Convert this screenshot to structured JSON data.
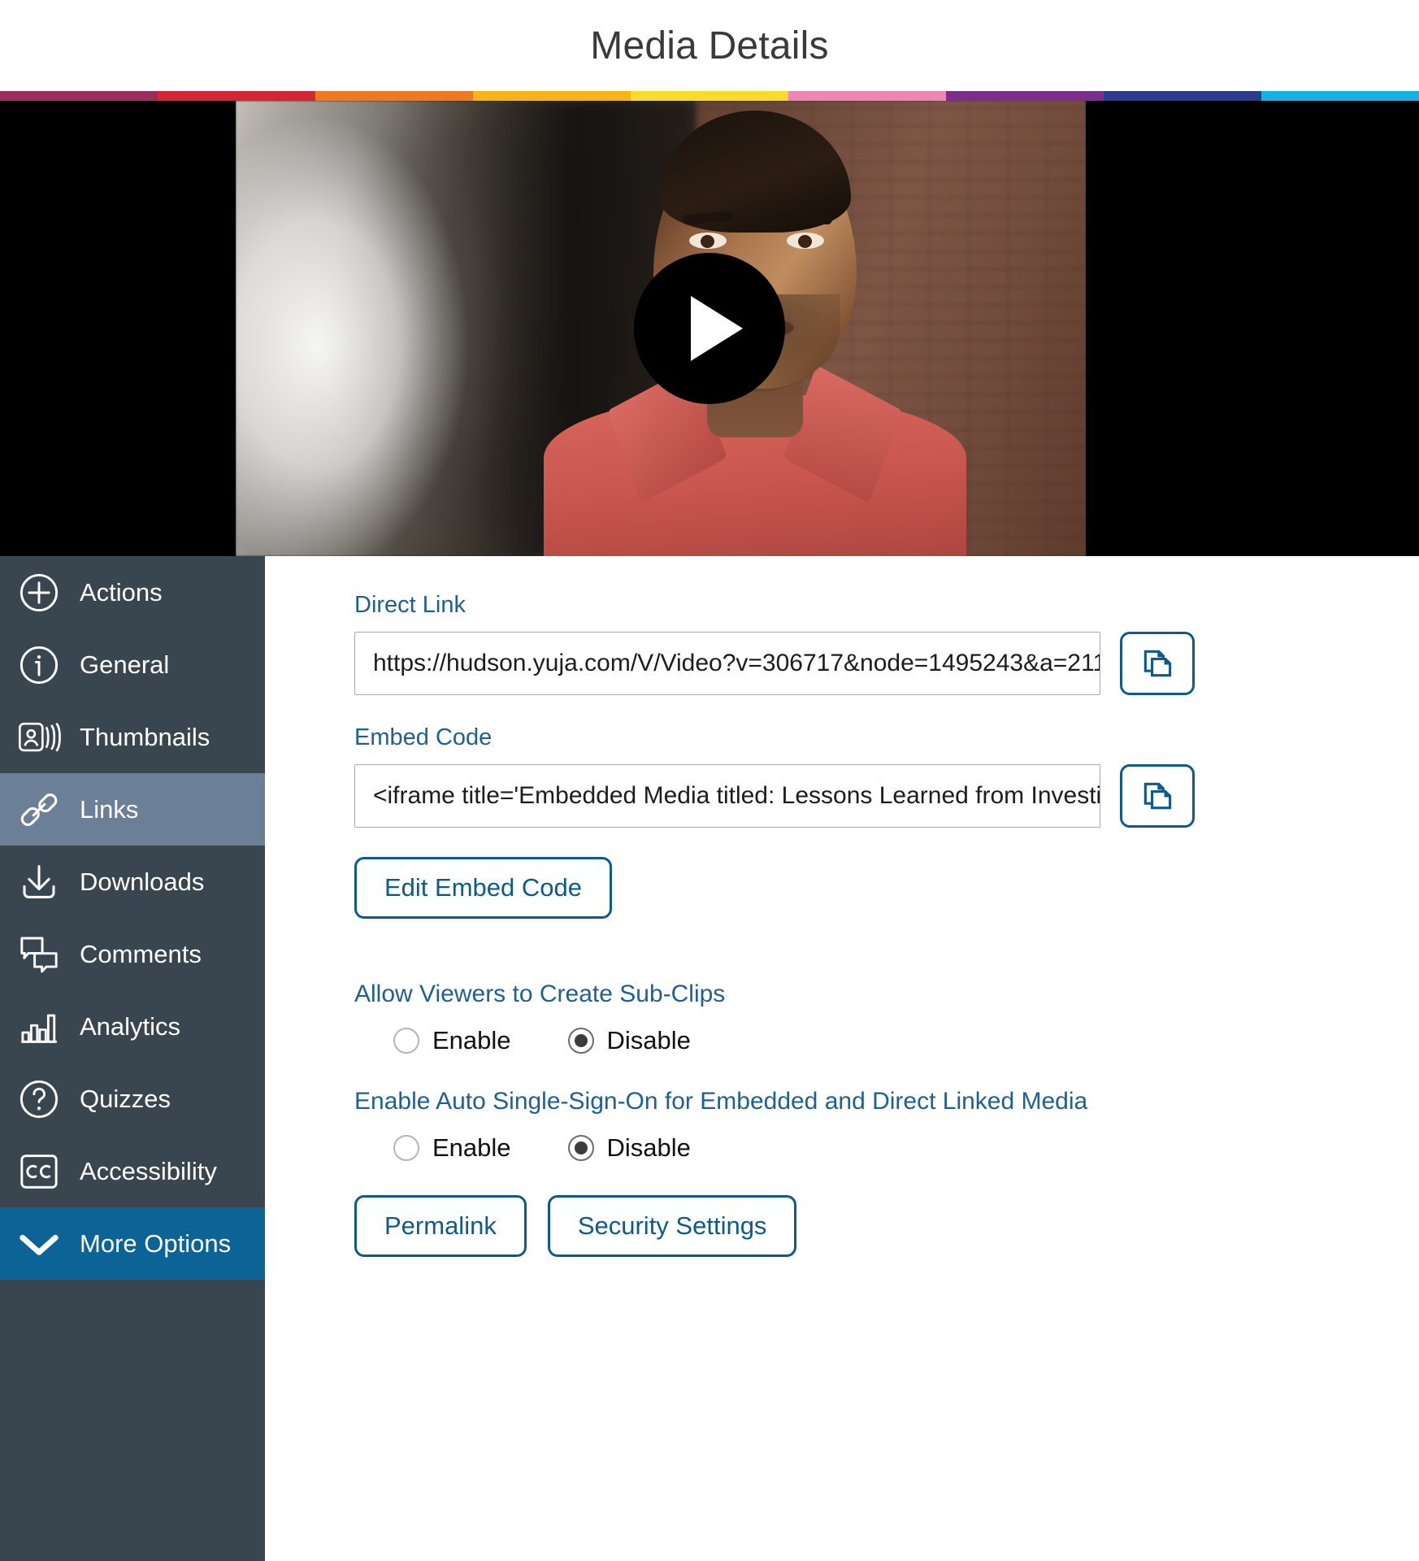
{
  "header": {
    "title": "Media Details"
  },
  "stripe_colors": [
    "#9c2b5e",
    "#d62534",
    "#ef7821",
    "#f9b317",
    "#fadb2a",
    "#ef85b5",
    "#7d2e8d",
    "#2d3b8f",
    "#12b2e3"
  ],
  "video": {
    "play_button_label": "Play",
    "icon": "play-icon"
  },
  "sidebar": {
    "items": [
      {
        "label": "Actions",
        "icon": "plus-circle-icon",
        "state": "normal"
      },
      {
        "label": "General",
        "icon": "info-circle-icon",
        "state": "normal"
      },
      {
        "label": "Thumbnails",
        "icon": "thumbnails-icon",
        "state": "normal"
      },
      {
        "label": "Links",
        "icon": "link-chain-icon",
        "state": "active"
      },
      {
        "label": "Downloads",
        "icon": "download-icon",
        "state": "normal"
      },
      {
        "label": "Comments",
        "icon": "comments-icon",
        "state": "normal"
      },
      {
        "label": "Analytics",
        "icon": "bar-chart-icon",
        "state": "normal"
      },
      {
        "label": "Quizzes",
        "icon": "question-circle-icon",
        "state": "normal"
      },
      {
        "label": "Accessibility",
        "icon": "closed-caption-icon",
        "state": "normal"
      },
      {
        "label": "More Options",
        "icon": "chevron-down-icon",
        "state": "more"
      }
    ],
    "colors": {
      "background": "#39464f",
      "active": "#6b8097",
      "more": "#0b6396"
    }
  },
  "main": {
    "direct_link": {
      "label": "Direct Link",
      "value": "https://hudson.yuja.com/V/Video?v=306717&node=1495243&a=211",
      "copy_icon": "copy-icon"
    },
    "embed_code": {
      "label": "Embed Code",
      "value": "<iframe title='Embedded Media titled: Lessons Learned from Investi",
      "copy_icon": "copy-icon"
    },
    "edit_embed_button": "Edit Embed Code",
    "sub_clips": {
      "title": "Allow Viewers to Create Sub-Clips",
      "options": [
        "Enable",
        "Disable"
      ],
      "selected": "Disable"
    },
    "auto_sso": {
      "title": "Enable Auto Single-Sign-On for Embedded and Direct Linked Media",
      "options": [
        "Enable",
        "Disable"
      ],
      "selected": "Disable"
    },
    "footer_buttons": [
      "Permalink",
      "Security Settings"
    ],
    "accent_color": "#0d5b8c",
    "label_color": "#1d5f96"
  }
}
